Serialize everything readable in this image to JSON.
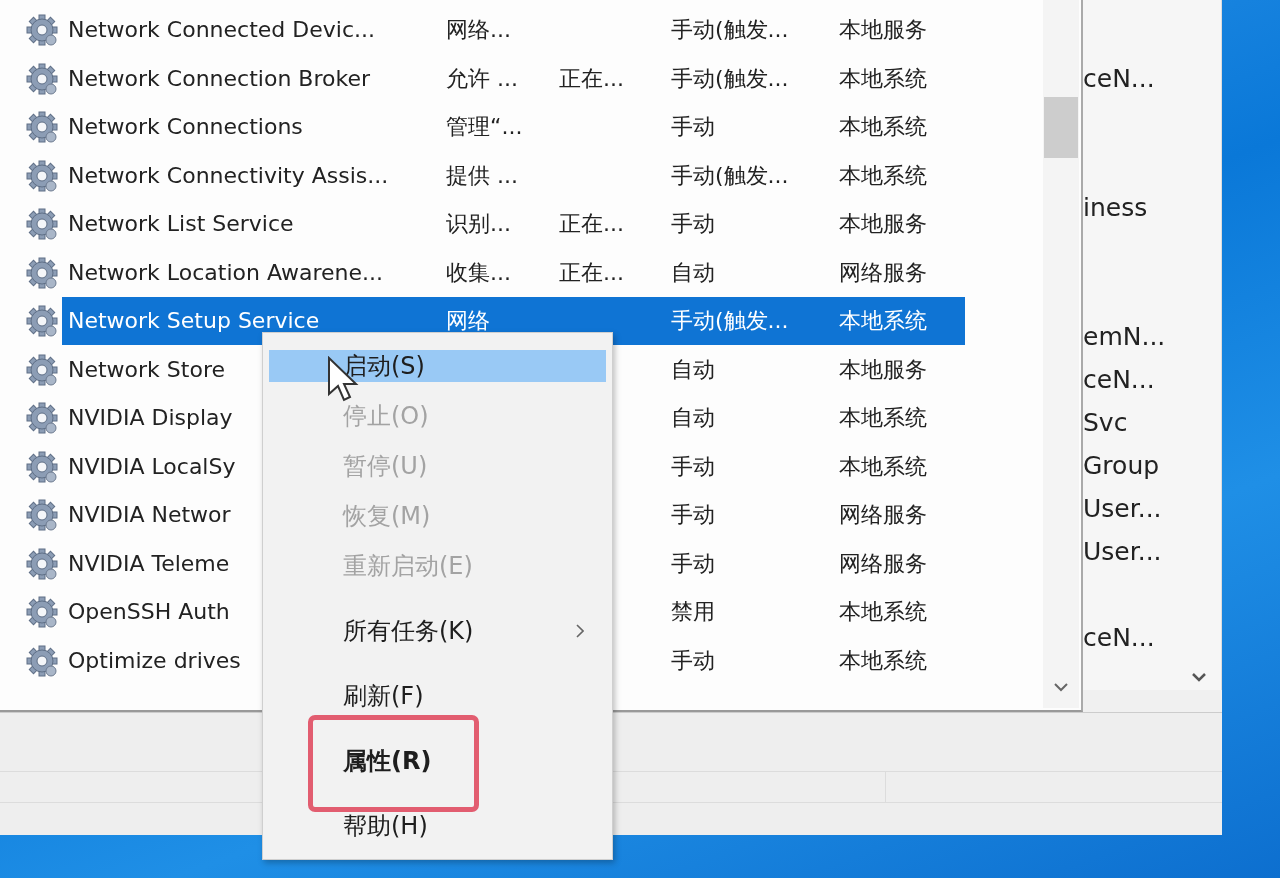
{
  "services": {
    "rows": [
      {
        "name": "Network Connected Devic...",
        "description": "网络...",
        "startup": "手动(触发...",
        "logon": "本地服务",
        "selected": false
      },
      {
        "name": "Network Connection Broker",
        "description": "允许 ...",
        "status": "正在...",
        "startup": "手动(触发...",
        "logon": "本地系统",
        "selected": false
      },
      {
        "name": "Network Connections",
        "description": "管理“...",
        "startup": "手动",
        "logon": "本地系统",
        "selected": false
      },
      {
        "name": "Network Connectivity Assis...",
        "description": "提供 ...",
        "startup": "手动(触发...",
        "logon": "本地系统",
        "selected": false
      },
      {
        "name": "Network List Service",
        "description": "识别...",
        "status": "正在...",
        "startup": "手动",
        "logon": "本地服务",
        "selected": false
      },
      {
        "name": "Network Location Awarene...",
        "description": "收集...",
        "status": "正在...",
        "startup": "自动",
        "logon": "网络服务",
        "selected": false
      },
      {
        "name": "Network Setup Service",
        "description": "网络",
        "startup": "手动(触发...",
        "logon": "本地系统",
        "selected": true
      },
      {
        "name": "Network Store",
        "startup": "自动",
        "logon": "本地服务",
        "selected": false
      },
      {
        "name": "NVIDIA Display",
        "startup": "自动",
        "logon": "本地系统",
        "selected": false
      },
      {
        "name": "NVIDIA LocalSy",
        "startup": "手动",
        "logon": "本地系统",
        "selected": false
      },
      {
        "name": "NVIDIA Networ",
        "startup": "手动",
        "logon": "网络服务",
        "selected": false
      },
      {
        "name": "NVIDIA Teleme",
        "startup": "手动",
        "logon": "网络服务",
        "selected": false
      },
      {
        "name": "OpenSSH Auth",
        "startup": "禁用",
        "logon": "本地系统",
        "selected": false
      },
      {
        "name": "Optimize drives",
        "startup": "手动",
        "logon": "本地系统",
        "selected": false
      }
    ]
  },
  "background_window": {
    "entries": [
      "ceN...",
      "iness",
      "emN...",
      "ceN...",
      "Svc",
      "Group",
      "User...",
      "User...",
      "ceN..."
    ]
  },
  "context_menu": {
    "items": [
      {
        "kind": "item",
        "label": "启动(S)",
        "disabled": false,
        "highlighted": true
      },
      {
        "kind": "item",
        "label": "停止(O)",
        "disabled": true,
        "highlighted": false
      },
      {
        "kind": "item",
        "label": "暂停(U)",
        "disabled": true,
        "highlighted": false
      },
      {
        "kind": "item",
        "label": "恢复(M)",
        "disabled": true,
        "highlighted": false
      },
      {
        "kind": "item",
        "label": "重新启动(E)",
        "disabled": true,
        "highlighted": false
      },
      {
        "kind": "separator"
      },
      {
        "kind": "submenu",
        "label": "所有任务(K)",
        "disabled": false,
        "highlighted": false
      },
      {
        "kind": "separator"
      },
      {
        "kind": "item",
        "label": "刷新(F)",
        "disabled": false,
        "highlighted": false
      },
      {
        "kind": "separator"
      },
      {
        "kind": "item",
        "label": "属性(R)",
        "disabled": false,
        "highlighted": false,
        "default": true,
        "annotated": true
      },
      {
        "kind": "separator"
      },
      {
        "kind": "item",
        "label": "帮助(H)",
        "disabled": false,
        "highlighted": false
      }
    ]
  }
}
